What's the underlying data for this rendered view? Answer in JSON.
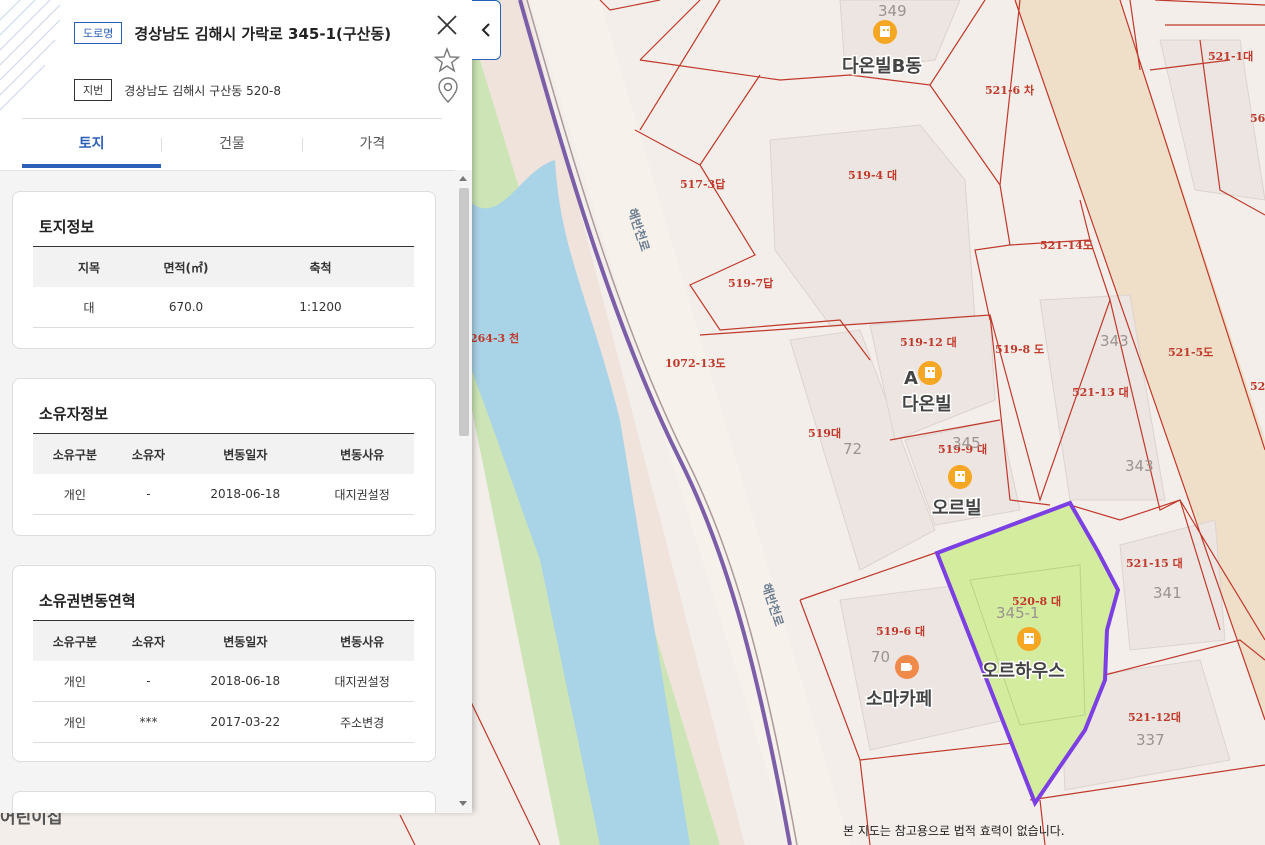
{
  "address": {
    "road_tag": "도로명",
    "road_address": "경상남도 김해시 가락로 345-1(구산동)",
    "lot_tag": "지번",
    "lot_address": "경상남도 김해시 구산동 520-8"
  },
  "tabs": [
    {
      "label": "토지",
      "active": true
    },
    {
      "label": "건물",
      "active": false
    },
    {
      "label": "가격",
      "active": false
    }
  ],
  "land_info": {
    "title": "토지정보",
    "headers": [
      "지목",
      "면적(㎡)",
      "축척"
    ],
    "rows": [
      [
        "대",
        "670.0",
        "1:1200"
      ]
    ]
  },
  "owner_info": {
    "title": "소유자정보",
    "headers": [
      "소유구분",
      "소유자",
      "변동일자",
      "변동사유"
    ],
    "rows": [
      [
        "개인",
        "-",
        "2018-06-18",
        "대지권설정"
      ]
    ]
  },
  "ownership_history": {
    "title": "소유권변동연혁",
    "headers": [
      "소유구분",
      "소유자",
      "변동일자",
      "변동사유"
    ],
    "rows": [
      [
        "개인",
        "-",
        "2018-06-18",
        "대지권설정"
      ],
      [
        "개인",
        "***",
        "2017-03-22",
        "주소변경"
      ]
    ]
  },
  "map": {
    "parcel_labels": [
      "349",
      "다온빌B동",
      "521-6 차",
      "521-1대",
      "56",
      "517-3답",
      "519-4 대",
      "521-14도",
      "519-7답",
      "264-3 천",
      "1072-13도",
      "519-12 대",
      "519-8 도",
      "343",
      "521-13 대",
      "521-5도",
      "52",
      "519대",
      "72",
      "A",
      "다온빌",
      "519-9 대",
      "345",
      "343",
      "오르빌",
      "520-8 대",
      "345-1",
      "521-15 대",
      "341",
      "519-6 대",
      "70",
      "오르하우스",
      "소마카페",
      "521-12대",
      "337"
    ],
    "road_names": [
      "해반천로",
      "해반천로"
    ],
    "edge_text": "어린이집",
    "notice": "본 지도는 참고용으로 법적 효력이 없습니다.",
    "colors": {
      "selected_parcel": "#7b3fe4",
      "parcel_fill": "#d4ec9e",
      "parcel_line": "#c0392b",
      "river": "#a9d3e6",
      "park": "#cde5b6"
    }
  }
}
